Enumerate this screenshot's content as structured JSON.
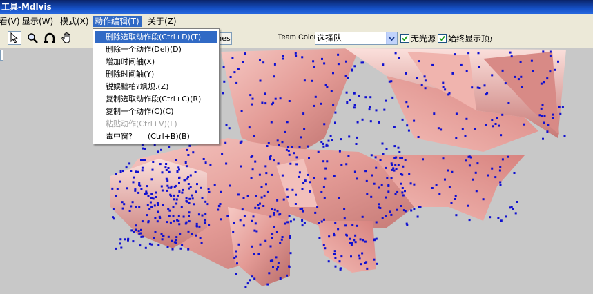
{
  "window": {
    "title": "工具-Mdlvis"
  },
  "menubar": {
    "items": [
      {
        "label": "看(V)"
      },
      {
        "label": "显示(W)"
      },
      {
        "label": "模式(X)"
      },
      {
        "label": "动作编辑(T)"
      },
      {
        "label": "关于(Z)"
      }
    ]
  },
  "toolbar": {
    "tools": [
      "arrow-cursor-icon",
      "magnifier-icon",
      "rotate-icon",
      "hand-icon"
    ],
    "tab_peek_label": "nes",
    "team_color_label": "Team Color",
    "team_color_value": "选择队",
    "checkbox_no_light_label": "无光源",
    "checkbox_no_light_checked": true,
    "checkbox_show_vertices_label": "始终显示顶点",
    "checkbox_show_vertices_checked": true
  },
  "dropdown": {
    "items": [
      {
        "label": "删除选取动作段(Ctrl+D)(T)",
        "state": "highlighted"
      },
      {
        "label": "删除一个动作(Del)(D)",
        "state": "normal"
      },
      {
        "label": "增加时间轴(X)",
        "state": "normal"
      },
      {
        "label": "删除时间轴(Y)",
        "state": "normal"
      },
      {
        "label": "锐娱黜柏?飒规.(Z)",
        "state": "normal"
      },
      {
        "label": "复制选取动作段(Ctrl+C)(R)",
        "state": "normal"
      },
      {
        "label": "复制一个动作(C)(C)",
        "state": "normal"
      },
      {
        "label": "粘贴动作(Ctrl+V)(L)",
        "state": "disabled"
      },
      {
        "label": "毒中窗?",
        "shortcut": "(Ctrl+B)(B)",
        "state": "normal"
      }
    ]
  },
  "colors": {
    "model_pink": "#e8a4a0",
    "vertex_blue": "#1010d0",
    "menu_highlight": "#316ac5",
    "viewport_bg": "#c8c8c8"
  }
}
